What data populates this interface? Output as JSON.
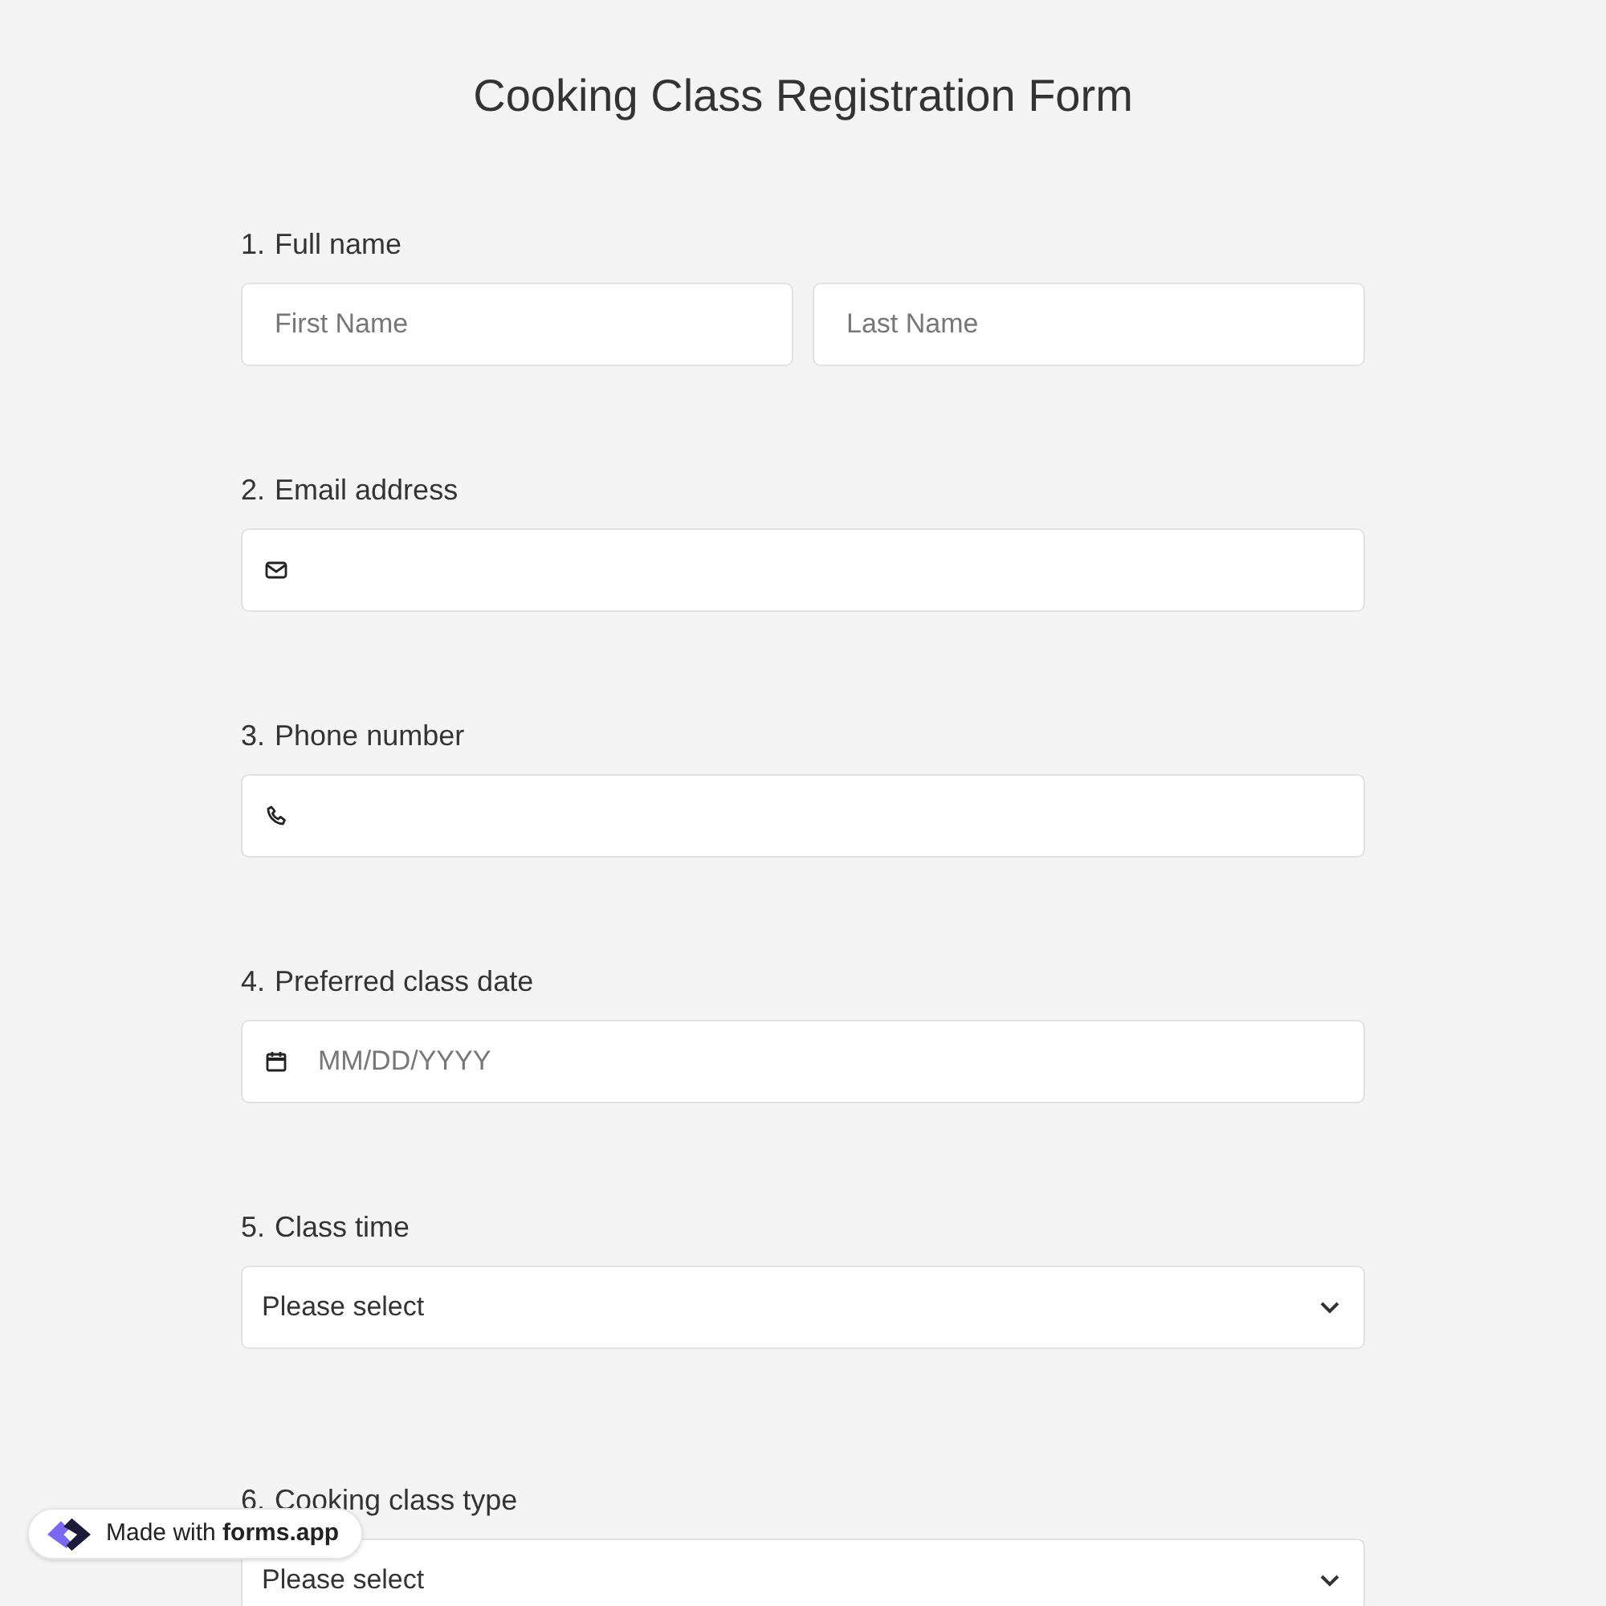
{
  "title": "Cooking Class Registration Form",
  "questions": [
    {
      "number": "1.",
      "label": "Full name",
      "kind": "name",
      "fields": [
        {
          "placeholder": "First Name"
        },
        {
          "placeholder": "Last Name"
        }
      ]
    },
    {
      "number": "2.",
      "label": "Email address",
      "kind": "email"
    },
    {
      "number": "3.",
      "label": "Phone number",
      "kind": "phone"
    },
    {
      "number": "4.",
      "label": "Preferred class date",
      "kind": "date",
      "placeholder": "MM/DD/YYYY"
    },
    {
      "number": "5.",
      "label": "Class time",
      "kind": "select",
      "value": "Please select"
    },
    {
      "number": "6.",
      "label": "Cooking class type",
      "kind": "select",
      "value": "Please select"
    }
  ],
  "badge": {
    "text": "Made with **forms.app**"
  }
}
